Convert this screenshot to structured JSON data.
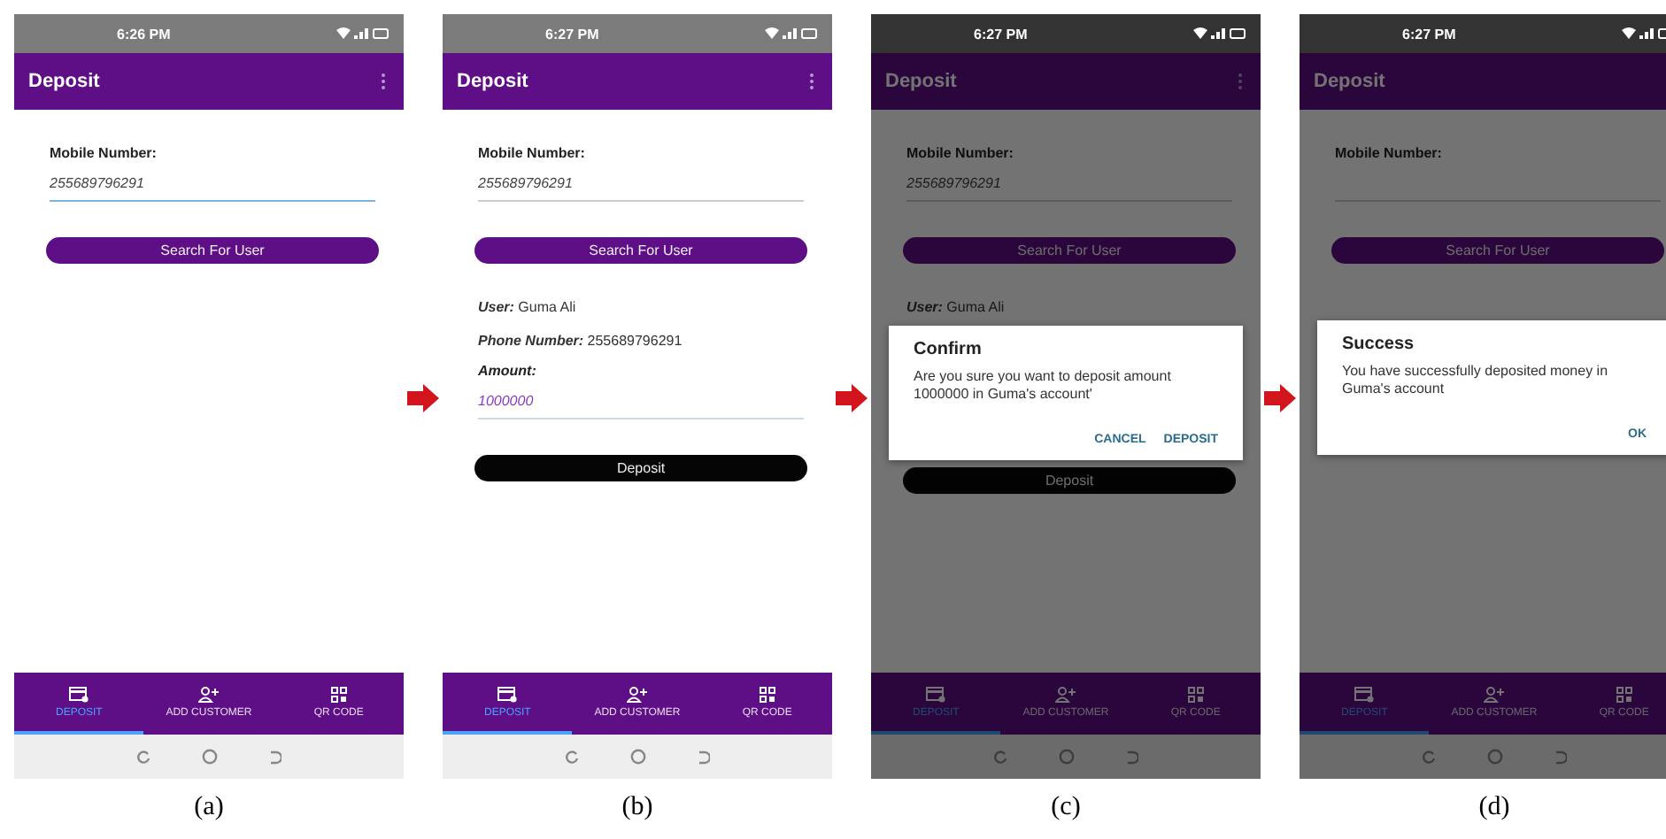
{
  "screens": [
    {
      "caption": "(a)",
      "status_time": "6:26 PM",
      "dimmed": false,
      "app_bar_title": "Deposit",
      "mobile_label": "Mobile Number:",
      "mobile_value": "255689796291",
      "mobile_focused": true,
      "search_button": "Search For User",
      "tabs": [
        {
          "kind": "card",
          "label": "DEPOSIT",
          "selected": true
        },
        {
          "kind": "person",
          "label": "ADD CUSTOMER",
          "selected": false
        },
        {
          "kind": "qr",
          "label": "QR CODE",
          "selected": false
        }
      ]
    },
    {
      "caption": "(b)",
      "status_time": "6:27 PM",
      "dimmed": false,
      "app_bar_title": "Deposit",
      "mobile_label": "Mobile Number:",
      "mobile_value": "255689796291",
      "mobile_focused": false,
      "search_button": "Search For User",
      "details": [
        {
          "label": "User:",
          "value": "Guma Ali"
        },
        {
          "label": "Phone Number:",
          "value": "255689796291"
        }
      ],
      "amount_field": {
        "label": "Amount:",
        "value": "1000000"
      },
      "deposit_button": "Deposit",
      "tabs": [
        {
          "kind": "card",
          "label": "DEPOSIT",
          "selected": true
        },
        {
          "kind": "person",
          "label": "ADD CUSTOMER",
          "selected": false
        },
        {
          "kind": "qr",
          "label": "QR CODE",
          "selected": false
        }
      ]
    },
    {
      "caption": "(c)",
      "status_time": "6:27 PM",
      "dimmed": true,
      "app_bar_title": "Deposit",
      "mobile_label": "Mobile Number:",
      "mobile_value": "255689796291",
      "mobile_focused": false,
      "search_button": "Search For User",
      "details": [
        {
          "label": "User:",
          "value": "Guma Ali"
        }
      ],
      "dialog": {
        "title": "Confirm",
        "message": "Are you sure you want to deposit amount 1000000 in Guma's account'",
        "actions": [
          "CANCEL",
          "DEPOSIT"
        ]
      },
      "deposit_button": "Deposit",
      "tabs": [
        {
          "kind": "card",
          "label": "DEPOSIT",
          "selected": true
        },
        {
          "kind": "person",
          "label": "ADD CUSTOMER",
          "selected": false
        },
        {
          "kind": "qr",
          "label": "QR CODE",
          "selected": false
        }
      ]
    },
    {
      "caption": "(d)",
      "status_time": "6:27 PM",
      "dimmed": true,
      "app_bar_title": "Deposit",
      "mobile_label": "Mobile Number:",
      "mobile_focused": false,
      "search_button": "Search For User",
      "dialog": {
        "title": "Success",
        "message": "You have successfully deposited money in Guma's account",
        "actions": [
          "OK"
        ]
      },
      "tabs": [
        {
          "kind": "card",
          "label": "DEPOSIT",
          "selected": true
        },
        {
          "kind": "person",
          "label": "ADD CUSTOMER",
          "selected": false
        },
        {
          "kind": "qr",
          "label": "QR CODE",
          "selected": false
        }
      ]
    }
  ]
}
